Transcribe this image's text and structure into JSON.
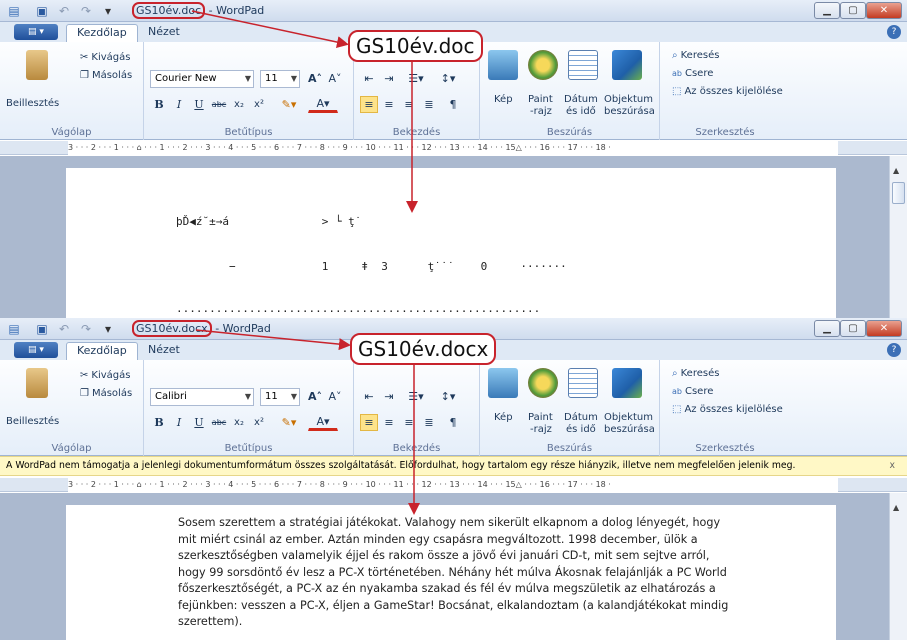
{
  "qat": {
    "dropdown": "▾"
  },
  "windows": [
    {
      "file": "GS10év.doc",
      "suffix": " - WordPad",
      "callout": "GS10év.doc",
      "fonts": {
        "name": "Courier New",
        "size": "11"
      },
      "doc_lines": [
        "þĎ◀ź˘±→á              > └ ţ˙",
        "        −             1     ǂ  3      ţ˙˙˙    0     ·······",
        "·······················································",
        "·······················································",
        "·······················································",
        "·······················································",
        "·······················································",
        "·······················································"
      ]
    },
    {
      "file": "GS10év.docx",
      "suffix": " - WordPad",
      "callout": "GS10év.docx",
      "fonts": {
        "name": "Calibri",
        "size": "11"
      },
      "infobar": "A WordPad nem támogatja a jelenlegi dokumentumformátum összes szolgáltatását. Előfordulhat, hogy tartalom egy része hiányzik, illetve nem megfelelően jelenik meg.",
      "infobar_close": "x",
      "doc_text": "Sosem szerettem a stratégiai játékokat. Valahogy nem sikerült elkapnom a dolog lényegét, hogy mit miért csinál az ember. Aztán minden egy csapásra megváltozott. 1998 december, ülök a szerkesztőségben valamelyik éjjel és rakom össze a jövő évi januári CD-t, mit sem sejtve arról, hogy 99 sorsdöntő év lesz a PC-X történetében. Néhány hét múlva Ákosnak felajánlják a PC World főszerkesztőségét, a PC-X az én nyakamba szakad és fél év múlva megszületik az elhatározás a fejünkben: vesszen a PC-X, éljen a GameStar! Bocsánat, elkalandoztam (a kalandjátékokat mindig szerettem)."
    }
  ],
  "tabs": {
    "file_menu": "▤ ▾",
    "home": "Kezdőlap",
    "view": "Nézet",
    "help": "?"
  },
  "ribbon": {
    "clipboard": {
      "paste": "Beillesztés",
      "cut": "Kivágás",
      "copy": "Másolás",
      "label": "Vágólap"
    },
    "font": {
      "label": "Betűtípus",
      "bold": "B",
      "italic": "I",
      "underline": "U",
      "strike": "abc",
      "sub": "x₂",
      "sup": "x²",
      "grow": "A˄",
      "shrink": "A˅"
    },
    "paragraph": {
      "label": "Bekezdés"
    },
    "insert": {
      "label": "Beszúrás",
      "picture": "Kép",
      "paint1": "Paint",
      "paint2": "-rajz",
      "datetime1": "Dátum",
      "datetime2": "és idő",
      "object1": "Objektum",
      "object2": "beszúrása"
    },
    "editing": {
      "label": "Szerkesztés",
      "find": "Keresés",
      "replace": "Csere",
      "select_all": "Az összes kijelölése"
    }
  },
  "ruler": "3 · · · 2 · · · 1 · · · ⌂ · · · 1 · · · 2 · · · 3 · · · 4 · · · 5 · · · 6 · · · 7 · · · 8 · · · 9 · · · 10 · · · 11 · · · 12 · · · 13 · · · 14 · · · 15△ · · · 16 · · · 17 · · · 18 ·",
  "colors": {
    "accent_red": "#c8232c",
    "ribbon_blue": "#1e395b",
    "infobar_bg": "#fff8c6"
  }
}
